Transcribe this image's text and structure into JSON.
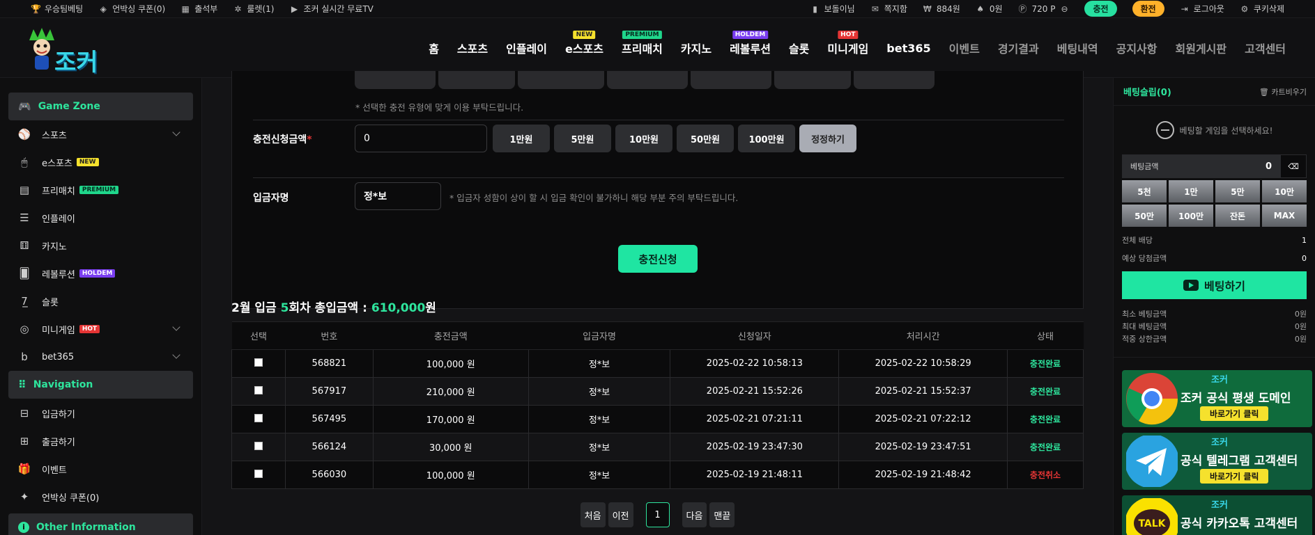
{
  "topbar": {
    "left": [
      {
        "icon": "trophy-icon",
        "label": "우승팀베팅"
      },
      {
        "icon": "gift-box-icon",
        "label": "언박싱 쿠폰(0)"
      },
      {
        "icon": "calendar-check-icon",
        "label": "출석부"
      },
      {
        "icon": "roulette-icon",
        "label": "룰렛(1)"
      },
      {
        "icon": "youtube-icon",
        "label": "조커 실시간 무료TV"
      }
    ],
    "user": "보돌이님",
    "messages": "쪽지함",
    "balance": "884원",
    "casino": "0원",
    "points": "720 P",
    "deposit_btn": "충전",
    "withdraw_btn": "환전",
    "logout": "로그아웃",
    "delete_cookies": "쿠키삭제"
  },
  "header": {
    "logo_text": "조커",
    "nav": [
      {
        "label": "홈"
      },
      {
        "label": "스포츠"
      },
      {
        "label": "인플레이"
      },
      {
        "label": "e스포츠",
        "badge": "NEW",
        "badge_class": "bg-new"
      },
      {
        "label": "프리매치",
        "badge": "PREMIUM",
        "badge_class": "bg-prem"
      },
      {
        "label": "카지노"
      },
      {
        "label": "레볼루션",
        "badge": "HOLDEM",
        "badge_class": "bg-hold"
      },
      {
        "label": "슬롯"
      },
      {
        "label": "미니게임",
        "badge": "HOT",
        "badge_class": "bg-hot"
      },
      {
        "label": "bet365"
      },
      {
        "label": "이벤트",
        "dim": true
      },
      {
        "label": "경기결과",
        "dim": true
      },
      {
        "label": "베팅내역",
        "dim": true
      },
      {
        "label": "공지사항",
        "dim": true
      },
      {
        "label": "회원게시판",
        "dim": true
      },
      {
        "label": "고객센터",
        "dim": true
      }
    ]
  },
  "sidebar": {
    "game_zone": "Game Zone",
    "games": [
      {
        "icon": "sports-ball-icon",
        "label": "스포츠",
        "chevron": true
      },
      {
        "icon": "mouse-icon",
        "label": "e스포츠",
        "badge": "NEW",
        "badge_class": "bg-new"
      },
      {
        "icon": "board-icon",
        "label": "프리매치",
        "badge": "PREMIUM",
        "badge_class": "bg-prem"
      },
      {
        "icon": "list-icon",
        "label": "인플레이"
      },
      {
        "icon": "dice-icon",
        "label": "카지노"
      },
      {
        "icon": "cards-icon",
        "label": "레볼루션",
        "badge": "HOLDEM",
        "badge_class": "bg-hold"
      },
      {
        "icon": "slot-777-icon",
        "label": "슬롯"
      },
      {
        "icon": "mini-game-icon",
        "label": "미니게임",
        "badge": "HOT",
        "badge_class": "bg-hot",
        "chevron": true
      },
      {
        "icon": "bet365-icon",
        "label": "bet365",
        "chevron": true
      }
    ],
    "navigation": "Navigation",
    "nav_items": [
      {
        "icon": "deposit-icon",
        "label": "입금하기"
      },
      {
        "icon": "withdraw-icon",
        "label": "출금하기"
      },
      {
        "icon": "gift-icon",
        "label": "이벤트"
      },
      {
        "icon": "coupon-icon",
        "label": "언박싱 쿠폰(0)"
      }
    ],
    "other": "Other Information"
  },
  "form": {
    "type_note": "* 선택한 충전 유형에 맞게 이용 부탁드립니다.",
    "amount_label": "충전신청금액",
    "amount_value": "0",
    "amount_buttons": [
      "1만원",
      "5만원",
      "10만원",
      "50만원",
      "100만원"
    ],
    "reset_button": "정정하기",
    "depositor_label": "입금자명",
    "depositor_value": "정*보",
    "depositor_note": "* 입금자 성함이 상이 할 시 입금 확인이 불가하니 해당 부분 주의 부탁드립니다.",
    "submit": "충전신청"
  },
  "summary": {
    "prefix": "2월 입금 ",
    "count": "5",
    "middle": "회차 총입금액 : ",
    "total": "610,000",
    "suffix": "원"
  },
  "table": {
    "columns": [
      "선택",
      "번호",
      "충전금액",
      "입금자명",
      "신청일자",
      "처리시간",
      "상태"
    ],
    "rows": [
      {
        "id": "568821",
        "amount": "100,000 원",
        "name": "정*보",
        "requested": "2025-02-22 10:58:13",
        "processed": "2025-02-22 10:58:29",
        "status": "충전완료",
        "ok": true
      },
      {
        "id": "567917",
        "amount": "210,000 원",
        "name": "정*보",
        "requested": "2025-02-21 15:52:26",
        "processed": "2025-02-21 15:52:37",
        "status": "충전완료",
        "ok": true
      },
      {
        "id": "567495",
        "amount": "170,000 원",
        "name": "정*보",
        "requested": "2025-02-21 07:21:11",
        "processed": "2025-02-21 07:22:12",
        "status": "충전완료",
        "ok": true
      },
      {
        "id": "566124",
        "amount": "30,000 원",
        "name": "정*보",
        "requested": "2025-02-19 23:47:30",
        "processed": "2025-02-19 23:47:51",
        "status": "충전완료",
        "ok": true
      },
      {
        "id": "566030",
        "amount": "100,000 원",
        "name": "정*보",
        "requested": "2025-02-19 21:48:11",
        "processed": "2025-02-19 21:48:42",
        "status": "충전취소",
        "ok": false
      }
    ]
  },
  "pager": {
    "first": "처음",
    "prev": "이전",
    "current": "1",
    "next": "다음",
    "last": "맨끝"
  },
  "betslip": {
    "title": "베팅슬립(0)",
    "clear": "카트비우기",
    "empty": "베팅할 게임을 선택하세요!",
    "amount_label": "베팅금액",
    "amount_value": "0",
    "quick": [
      "5천",
      "1만",
      "5만",
      "10만",
      "50만",
      "100만",
      "잔돈",
      "MAX"
    ],
    "total_odds_label": "전체 배당",
    "total_odds": "1",
    "expected_label": "예상 당첨금액",
    "expected": "0",
    "bet_button": "베팅하기",
    "min_label": "최소 베팅금액",
    "min": "0원",
    "max_label": "최대 베팅금액",
    "max": "0원",
    "limit_label": "적중 상한금액",
    "limit": "0원"
  },
  "banners": [
    {
      "text": "조커 공식 평생 도메인",
      "sub": "바로가기 클릭",
      "bg": "#0f6b3c",
      "icon": "chrome-icon"
    },
    {
      "text": "공식 텔레그램 고객센터",
      "sub": "바로가기 클릭",
      "bg": "#0e5a3a",
      "icon": "telegram-icon"
    },
    {
      "text": "공식 카카오톡 고객센터",
      "sub": "",
      "bg": "#0c4f33",
      "icon": "kakaotalk-icon"
    }
  ],
  "banner_logo": "조커",
  "colors": {
    "accent": "#2ee59d",
    "button_green": "#1fe5a2",
    "cancel": "#e53535",
    "orange": "#ffb12a"
  }
}
